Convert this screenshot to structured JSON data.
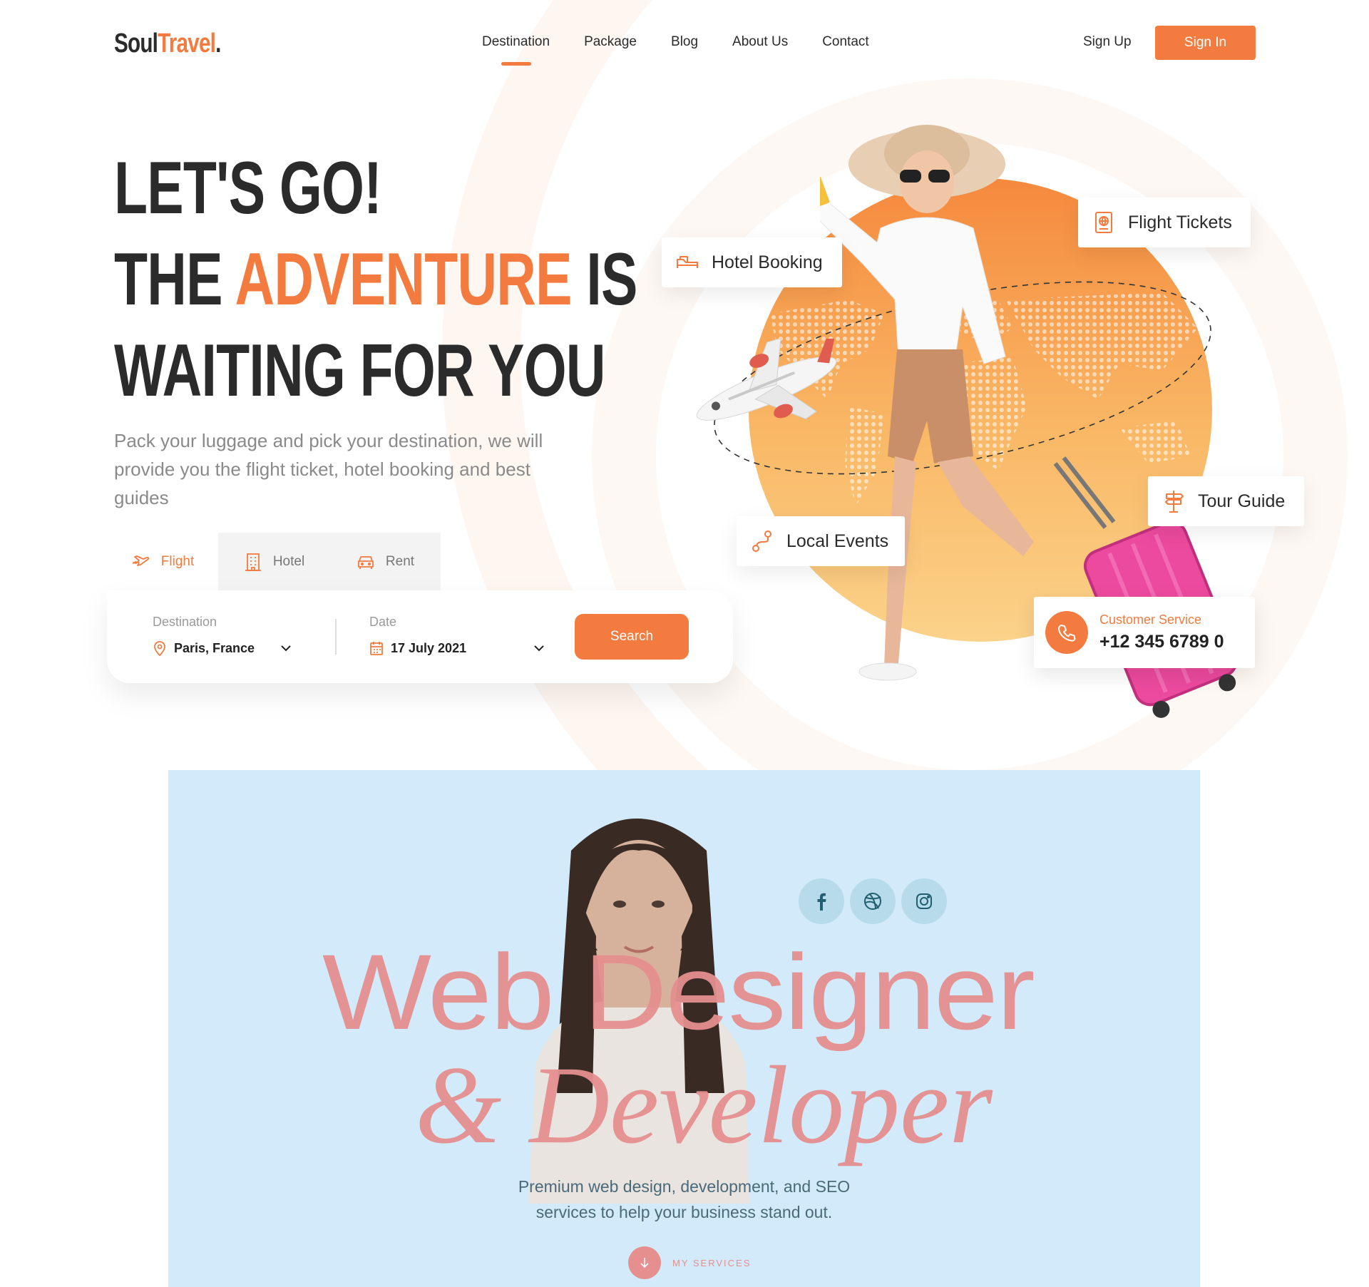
{
  "header": {
    "logo_main": "Soul",
    "logo_accent": "Travel",
    "logo_dot": ".",
    "nav": [
      "Destination",
      "Package",
      "Blog",
      "About Us",
      "Contact"
    ],
    "active_nav": "Destination",
    "signup_label": "Sign Up",
    "signin_label": "Sign In"
  },
  "hero": {
    "line1": "LET'S GO!",
    "line2_pre": "THE ",
    "line2_accent": "ADVENTURE",
    "line2_post": " IS",
    "line3": "WAITING FOR YOU",
    "subtext": "Pack your luggage and pick your destination, we will provide you the flight ticket, hotel booking and best guides"
  },
  "search": {
    "tabs": [
      {
        "label": "Flight",
        "icon": "plane-icon"
      },
      {
        "label": "Hotel",
        "icon": "building-icon"
      },
      {
        "label": "Rent",
        "icon": "car-icon"
      }
    ],
    "destination_label": "Destination",
    "destination_value": "Paris, France",
    "date_label": "Date",
    "date_value": "17 July 2021",
    "search_label": "Search"
  },
  "features": {
    "hotel": "Hotel Booking",
    "flight": "Flight Tickets",
    "events": "Local Events",
    "guide": "Tour Guide"
  },
  "customer_service": {
    "label": "Customer Service",
    "phone": "+12 345 6789 0"
  },
  "portfolio": {
    "title_line1": "Web Designer",
    "title_line2": "& Developer",
    "tagline_line1": "Premium web design, development, and SEO",
    "tagline_line2": "services to help your business stand out.",
    "services_label": "MY SERVICES",
    "socials": [
      "facebook-icon",
      "dribbble-icon",
      "instagram-icon"
    ]
  },
  "colors": {
    "accent": "#f37b3f",
    "dark": "#2b2b2b",
    "muted": "#8a8a8a",
    "portfolio_bg": "#d2eaf9",
    "portfolio_accent": "#e58f8f"
  }
}
